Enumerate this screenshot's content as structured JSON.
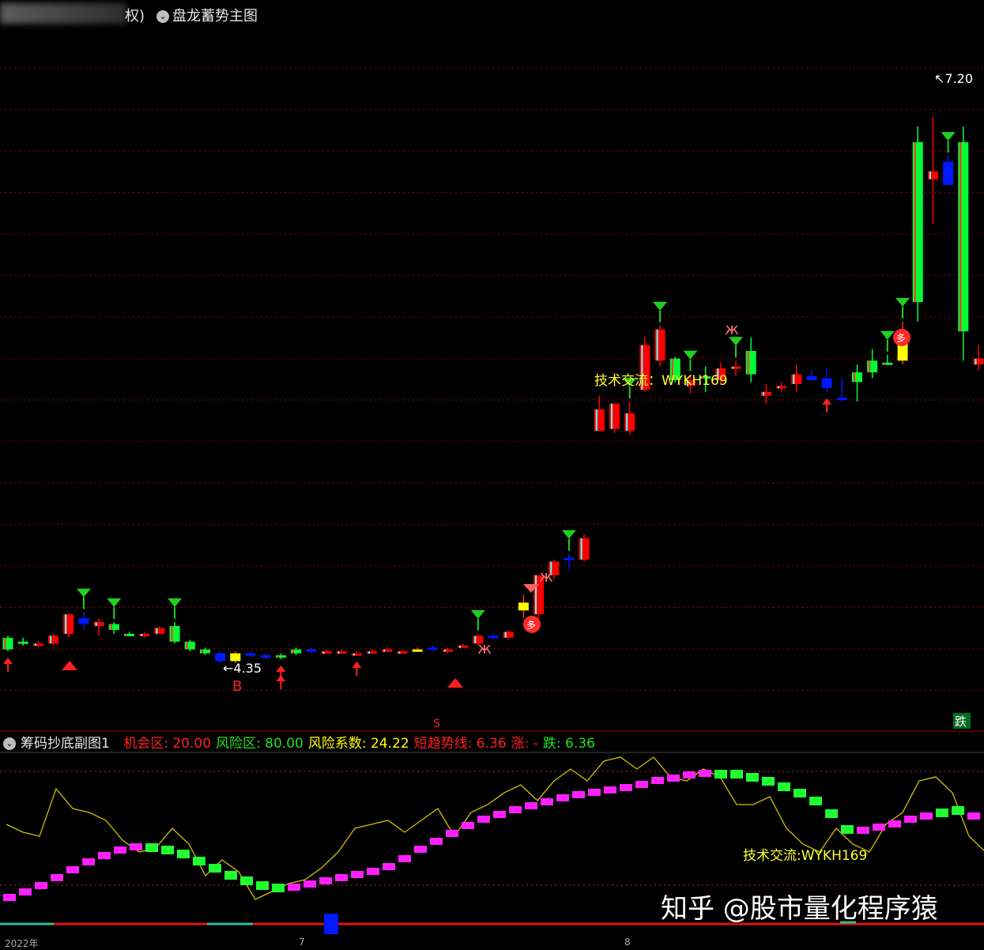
{
  "header": {
    "title_prefix": "权)",
    "title": "盘龙蓄势主图"
  },
  "main_chart": {
    "type": "candlestick",
    "label_high": "7.20",
    "label_low": "4.35",
    "label_b": "B",
    "label_s": "S",
    "label_die": "跌",
    "label_duo": "多",
    "watermark_text": "技术交流：WYKH169",
    "colors": {
      "up": "#ff0000",
      "down": "#00ff33",
      "blue": "#0018ff",
      "yellow": "#ffff00",
      "grid": "#a00000"
    }
  },
  "sub_chart": {
    "title": "筹码抄底副图1",
    "items": [
      {
        "label": "机会区:",
        "value": "20.00",
        "color": "#ff2020"
      },
      {
        "label": "风险区:",
        "value": "80.00",
        "color": "#20e020"
      },
      {
        "label": "风险系数:",
        "value": "24.22",
        "color": "#ffff00"
      },
      {
        "label": "短趋势线:",
        "value": "6.36",
        "color": "#ff2020"
      },
      {
        "label": "涨:",
        "value": "-",
        "color": "#ff2020"
      },
      {
        "label": "跌:",
        "value": "6.36",
        "color": "#20e020"
      }
    ],
    "watermark_text": "技术交流:WYKH169"
  },
  "footer": {
    "dates": [
      "2022年",
      "7",
      "8"
    ],
    "brand": "知乎 @股市量化程序猿"
  },
  "chart_data": {
    "type": "candlestick",
    "price_range": [
      4.2,
      7.4
    ],
    "candles": [
      {
        "o": 4.48,
        "h": 4.49,
        "l": 4.41,
        "c": 4.42,
        "col": "g"
      },
      {
        "o": 4.46,
        "h": 4.48,
        "l": 4.44,
        "c": 4.45,
        "col": "g"
      },
      {
        "o": 4.44,
        "h": 4.46,
        "l": 4.43,
        "c": 4.45,
        "col": "r"
      },
      {
        "o": 4.45,
        "h": 4.5,
        "l": 4.44,
        "c": 4.49,
        "col": "r"
      },
      {
        "o": 4.5,
        "h": 4.6,
        "l": 4.48,
        "c": 4.6,
        "col": "r"
      },
      {
        "o": 4.58,
        "h": 4.61,
        "l": 4.52,
        "c": 4.55,
        "col": "b"
      },
      {
        "o": 4.56,
        "h": 4.58,
        "l": 4.49,
        "c": 4.54,
        "col": "r"
      },
      {
        "o": 4.55,
        "h": 4.56,
        "l": 4.5,
        "c": 4.52,
        "col": "g"
      },
      {
        "o": 4.5,
        "h": 4.51,
        "l": 4.49,
        "c": 4.5,
        "col": "g"
      },
      {
        "o": 4.5,
        "h": 4.51,
        "l": 4.48,
        "c": 4.5,
        "col": "r"
      },
      {
        "o": 4.5,
        "h": 4.54,
        "l": 4.5,
        "c": 4.53,
        "col": "r"
      },
      {
        "o": 4.54,
        "h": 4.56,
        "l": 4.45,
        "c": 4.46,
        "col": "g"
      },
      {
        "o": 4.46,
        "h": 4.47,
        "l": 4.41,
        "c": 4.42,
        "col": "g"
      },
      {
        "o": 4.42,
        "h": 4.43,
        "l": 4.39,
        "c": 4.4,
        "col": "g"
      },
      {
        "o": 4.4,
        "h": 4.41,
        "l": 4.35,
        "c": 4.36,
        "col": "b"
      },
      {
        "o": 4.36,
        "h": 4.41,
        "l": 4.35,
        "c": 4.4,
        "col": "y"
      },
      {
        "o": 4.4,
        "h": 4.41,
        "l": 4.38,
        "c": 4.39,
        "col": "b"
      },
      {
        "o": 4.39,
        "h": 4.4,
        "l": 4.37,
        "c": 4.38,
        "col": "b"
      },
      {
        "o": 4.38,
        "h": 4.4,
        "l": 4.37,
        "c": 4.39,
        "col": "g"
      },
      {
        "o": 4.4,
        "h": 4.43,
        "l": 4.39,
        "c": 4.42,
        "col": "g"
      },
      {
        "o": 4.42,
        "h": 4.43,
        "l": 4.4,
        "c": 4.41,
        "col": "b"
      },
      {
        "o": 4.41,
        "h": 4.42,
        "l": 4.4,
        "c": 4.41,
        "col": "r"
      },
      {
        "o": 4.41,
        "h": 4.42,
        "l": 4.4,
        "c": 4.4,
        "col": "r"
      },
      {
        "o": 4.4,
        "h": 4.41,
        "l": 4.39,
        "c": 4.4,
        "col": "r"
      },
      {
        "o": 4.4,
        "h": 4.42,
        "l": 4.4,
        "c": 4.41,
        "col": "r"
      },
      {
        "o": 4.41,
        "h": 4.43,
        "l": 4.41,
        "c": 4.42,
        "col": "r"
      },
      {
        "o": 4.41,
        "h": 4.42,
        "l": 4.41,
        "c": 4.41,
        "col": "r"
      },
      {
        "o": 4.41,
        "h": 4.43,
        "l": 4.41,
        "c": 4.42,
        "col": "y"
      },
      {
        "o": 4.42,
        "h": 4.44,
        "l": 4.41,
        "c": 4.43,
        "col": "b"
      },
      {
        "o": 4.42,
        "h": 4.43,
        "l": 4.4,
        "c": 4.42,
        "col": "r"
      },
      {
        "o": 4.43,
        "h": 4.45,
        "l": 4.43,
        "c": 4.44,
        "col": "r"
      },
      {
        "o": 4.45,
        "h": 4.5,
        "l": 4.44,
        "c": 4.49,
        "col": "r"
      },
      {
        "o": 4.48,
        "h": 4.5,
        "l": 4.47,
        "c": 4.49,
        "col": "b"
      },
      {
        "o": 4.48,
        "h": 4.52,
        "l": 4.47,
        "c": 4.51,
        "col": "r"
      },
      {
        "o": 4.62,
        "h": 4.7,
        "l": 4.58,
        "c": 4.66,
        "col": "y"
      },
      {
        "o": 4.6,
        "h": 4.8,
        "l": 4.57,
        "c": 4.8,
        "col": "r"
      },
      {
        "o": 4.8,
        "h": 4.88,
        "l": 4.78,
        "c": 4.87,
        "col": "r"
      },
      {
        "o": 4.88,
        "h": 4.91,
        "l": 4.83,
        "c": 4.89,
        "col": "b"
      },
      {
        "o": 4.88,
        "h": 5.01,
        "l": 4.87,
        "c": 4.99,
        "col": "r"
      },
      {
        "o": 5.65,
        "h": 5.72,
        "l": 5.54,
        "c": 5.54,
        "col": "r"
      },
      {
        "o": 5.55,
        "h": 5.68,
        "l": 5.53,
        "c": 5.68,
        "col": "r"
      },
      {
        "o": 5.54,
        "h": 5.69,
        "l": 5.52,
        "c": 5.63,
        "col": "r"
      },
      {
        "o": 5.75,
        "h": 6.02,
        "l": 5.74,
        "c": 5.98,
        "col": "r"
      },
      {
        "o": 5.9,
        "h": 6.08,
        "l": 5.87,
        "c": 6.06,
        "col": "r"
      },
      {
        "o": 5.91,
        "h": 5.92,
        "l": 5.79,
        "c": 5.8,
        "col": "g"
      },
      {
        "o": 5.77,
        "h": 5.83,
        "l": 5.73,
        "c": 5.8,
        "col": "r"
      },
      {
        "o": 5.81,
        "h": 5.87,
        "l": 5.74,
        "c": 5.82,
        "col": "g"
      },
      {
        "o": 5.8,
        "h": 5.89,
        "l": 5.78,
        "c": 5.86,
        "col": "r"
      },
      {
        "o": 5.86,
        "h": 5.9,
        "l": 5.82,
        "c": 5.87,
        "col": "r"
      },
      {
        "o": 5.95,
        "h": 6.02,
        "l": 5.79,
        "c": 5.83,
        "col": "g"
      },
      {
        "o": 5.72,
        "h": 5.78,
        "l": 5.68,
        "c": 5.74,
        "col": "r"
      },
      {
        "o": 5.76,
        "h": 5.79,
        "l": 5.74,
        "c": 5.77,
        "col": "r"
      },
      {
        "o": 5.78,
        "h": 5.88,
        "l": 5.74,
        "c": 5.83,
        "col": "r"
      },
      {
        "o": 5.82,
        "h": 5.85,
        "l": 5.8,
        "c": 5.8,
        "col": "b"
      },
      {
        "o": 5.76,
        "h": 5.86,
        "l": 5.74,
        "c": 5.81,
        "col": "b"
      },
      {
        "o": 5.7,
        "h": 5.81,
        "l": 5.69,
        "c": 5.71,
        "col": "b"
      },
      {
        "o": 5.79,
        "h": 5.88,
        "l": 5.69,
        "c": 5.84,
        "col": "g"
      },
      {
        "o": 5.84,
        "h": 5.96,
        "l": 5.81,
        "c": 5.9,
        "col": "g"
      },
      {
        "o": 5.89,
        "h": 5.93,
        "l": 5.88,
        "c": 5.89,
        "col": "g"
      },
      {
        "o": 5.9,
        "h": 6.1,
        "l": 5.88,
        "c": 6.03,
        "col": "y"
      },
      {
        "o": 6.2,
        "h": 7.1,
        "l": 6.1,
        "c": 7.02,
        "col": "g"
      },
      {
        "o": 6.87,
        "h": 7.15,
        "l": 6.6,
        "c": 6.83,
        "col": "r"
      },
      {
        "o": 6.92,
        "h": 6.95,
        "l": 6.8,
        "c": 6.8,
        "col": "b"
      },
      {
        "o": 7.02,
        "h": 7.1,
        "l": 5.9,
        "c": 6.05,
        "col": "g"
      },
      {
        "o": 5.91,
        "h": 5.98,
        "l": 5.85,
        "c": 5.88,
        "col": "r"
      }
    ]
  }
}
